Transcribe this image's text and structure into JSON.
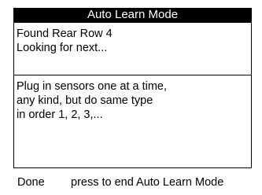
{
  "title": "Auto Learn Mode",
  "status": {
    "lines": [
      "Found Rear Row 4",
      "Looking for next..."
    ]
  },
  "instructions": {
    "lines": [
      "Plug in sensors one at a time,",
      "any kind, but do same type",
      "in order 1, 2, 3,..."
    ]
  },
  "softkey": {
    "label": "Done",
    "hint": "press to end Auto Learn Mode"
  },
  "colors": {
    "title_background": "#000000",
    "title_text": "#ffffff",
    "background": "#ffffff",
    "text": "#000000"
  }
}
